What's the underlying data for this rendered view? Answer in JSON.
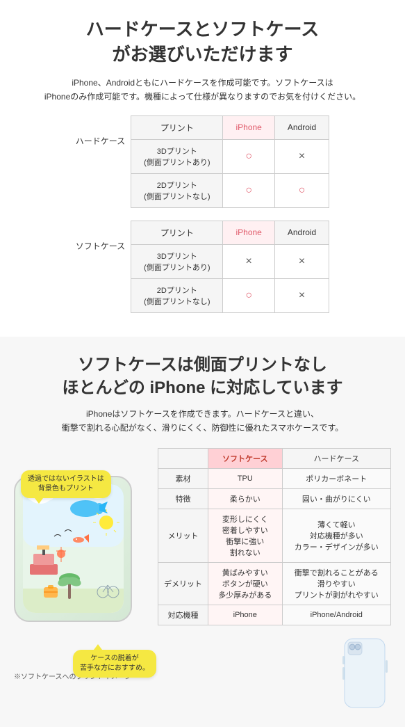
{
  "section1": {
    "title": "ハードケースとソフトケース\nがお選びいただけます",
    "description": "iPhone、Androidともにハードケースを作成可能です。ソフトケースは\niPhoneのみ作成可能です。機種によって仕様が異なりますのでお気を付けください。",
    "hard_case_label": "ハードケース",
    "soft_case_label": "ソフトケース",
    "table1": {
      "headers": [
        "プリント",
        "iPhone",
        "Android"
      ],
      "rows": [
        {
          "label": "3Dプリント\n(側面プリントあり)",
          "iphone": "○",
          "android": "×"
        },
        {
          "label": "2Dプリント\n(側面プリントなし)",
          "iphone": "○",
          "android": "○"
        }
      ]
    },
    "table2": {
      "headers": [
        "プリント",
        "iPhone",
        "Android"
      ],
      "rows": [
        {
          "label": "3Dプリント\n(側面プリントあり)",
          "iphone": "×",
          "android": "×"
        },
        {
          "label": "2Dプリント\n(側面プリントなし)",
          "iphone": "○",
          "android": "×"
        }
      ]
    }
  },
  "section2": {
    "title": "ソフトケースは側面プリントなし\nほとんどの iPhone に対応しています",
    "description": "iPhoneはソフトケースを作成できます。ハードケースと違い、\n衝撃で割れる心配がなく、滑りにくく、防御性に優れたスマホケースです。",
    "speech_bubble": "透過ではないイラストは\n背景色もプリント",
    "bottom_bubble": "ケースの脱着が\n苦手な方におすすめ。",
    "phone_note": "※ソフトケースへのプリントイメージ",
    "compare_table": {
      "col_soft": "ソフトケース",
      "col_hard": "ハードケース",
      "rows": [
        {
          "label": "素材",
          "soft": "TPU",
          "hard": "ポリカーボネート"
        },
        {
          "label": "特徴",
          "soft": "柔らかい",
          "hard": "固い・曲がりにくい"
        },
        {
          "label": "メリット",
          "soft": "変形しにくく\n密着しやすい\n衝撃に強い\n割れない",
          "hard": "薄くて軽い\n対応機種が多い\nカラー・デザインが多い"
        },
        {
          "label": "デメリット",
          "soft": "黄ばみやすい\nボタンが硬い\n多少厚みがある",
          "hard": "衝撃で割れることがある\n滑りやすい\nプリントが剥がれやすい"
        },
        {
          "label": "対応機種",
          "soft": "iPhone",
          "hard": "iPhone/Android"
        }
      ]
    }
  }
}
